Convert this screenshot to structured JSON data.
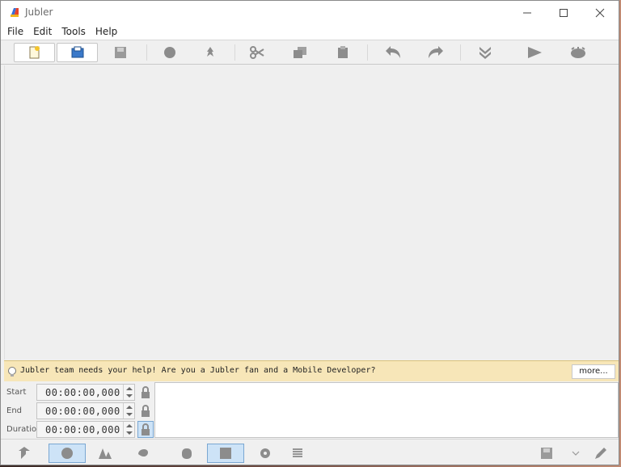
{
  "window": {
    "title": "Jubler",
    "controls": [
      "minimize-icon",
      "maximize-icon",
      "close-icon"
    ]
  },
  "menu": {
    "items": [
      {
        "label": "File"
      },
      {
        "label": "Edit"
      },
      {
        "label": "Tools"
      },
      {
        "label": "Help"
      }
    ]
  },
  "toolbar": {
    "buttons": [
      {
        "icon": "new-file-icon"
      },
      {
        "icon": "open-file-icon"
      },
      {
        "icon": "save-icon"
      },
      {
        "icon": "info-icon"
      },
      {
        "icon": "pin-icon"
      },
      {
        "icon": "cut-icon"
      },
      {
        "icon": "copy-icon"
      },
      {
        "icon": "paste-icon"
      },
      {
        "icon": "undo-icon"
      },
      {
        "icon": "redo-icon"
      },
      {
        "icon": "jump-down-icon"
      },
      {
        "icon": "play-icon"
      },
      {
        "icon": "preview-icon"
      }
    ]
  },
  "notice": {
    "text": "Jubler team needs your help! Are you a Jubler fan and a Mobile Developer?",
    "more_label": "more..."
  },
  "timing": {
    "start_label": "Start",
    "start_value": "00:00:00,000",
    "end_label": "End",
    "end_value": "00:00:00,000",
    "duration_label": "Duration",
    "duration_value": "00:00:00,000"
  },
  "bottombar": {
    "buttons": [
      {
        "icon": "arrow-icon"
      },
      {
        "icon": "circle-icon",
        "active": true
      },
      {
        "icon": "text-style-icon"
      },
      {
        "icon": "shape-icon"
      },
      {
        "icon": "database-icon"
      },
      {
        "icon": "image-icon",
        "active": true
      },
      {
        "icon": "settings-icon"
      },
      {
        "icon": "list-icon"
      },
      {
        "icon": "save-style-icon"
      },
      {
        "icon": "dropdown-icon"
      },
      {
        "icon": "edit-pen-icon"
      }
    ]
  },
  "colors": {
    "accent": "#7aa7d2",
    "notice_bg": "#f7e6b8",
    "icon_gray": "#8c8c8c"
  }
}
